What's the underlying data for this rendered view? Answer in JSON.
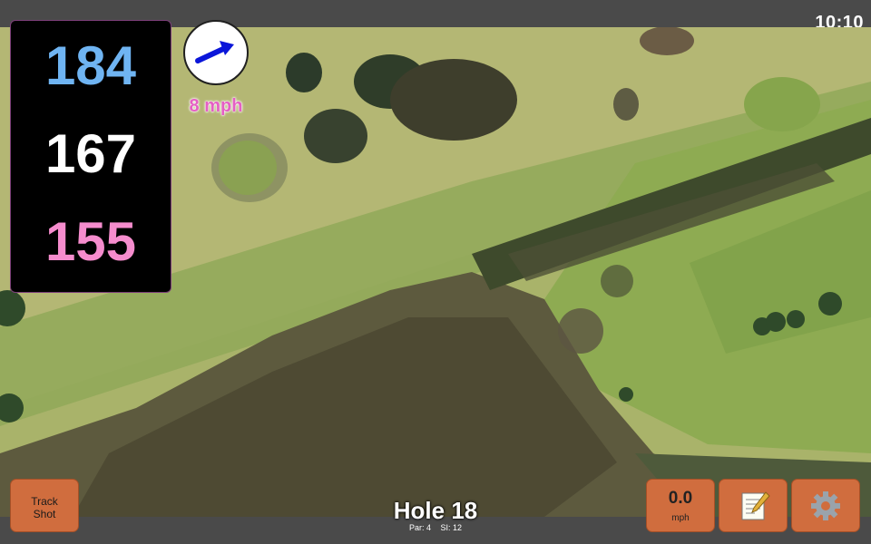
{
  "status_bar": {
    "time": "10:10"
  },
  "distances": {
    "back": "184",
    "middle": "167",
    "front": "155"
  },
  "wind": {
    "speed_label": "8 mph",
    "arrow_icon": "wind-direction-arrow-icon",
    "colors": {
      "arrow": "#0b16d9",
      "speed_text": "#e55fc4"
    }
  },
  "buttons": {
    "track_shot": {
      "line1": "Track",
      "line2": "Shot"
    },
    "speed": {
      "value": "0.0",
      "unit": "mph"
    },
    "notes_icon": "scorecard-note-icon",
    "settings_icon": "gear-icon"
  },
  "hole": {
    "title": "Hole 18",
    "par": "Par: 4",
    "si": "SI: 12"
  },
  "colors": {
    "button_bg": "#d06d3e",
    "back_distance": "#6fb4f2",
    "middle_distance": "#ffffff",
    "front_distance": "#f58ccd",
    "panel_bg": "#000000",
    "bar_bg": "#4a4a4a"
  }
}
